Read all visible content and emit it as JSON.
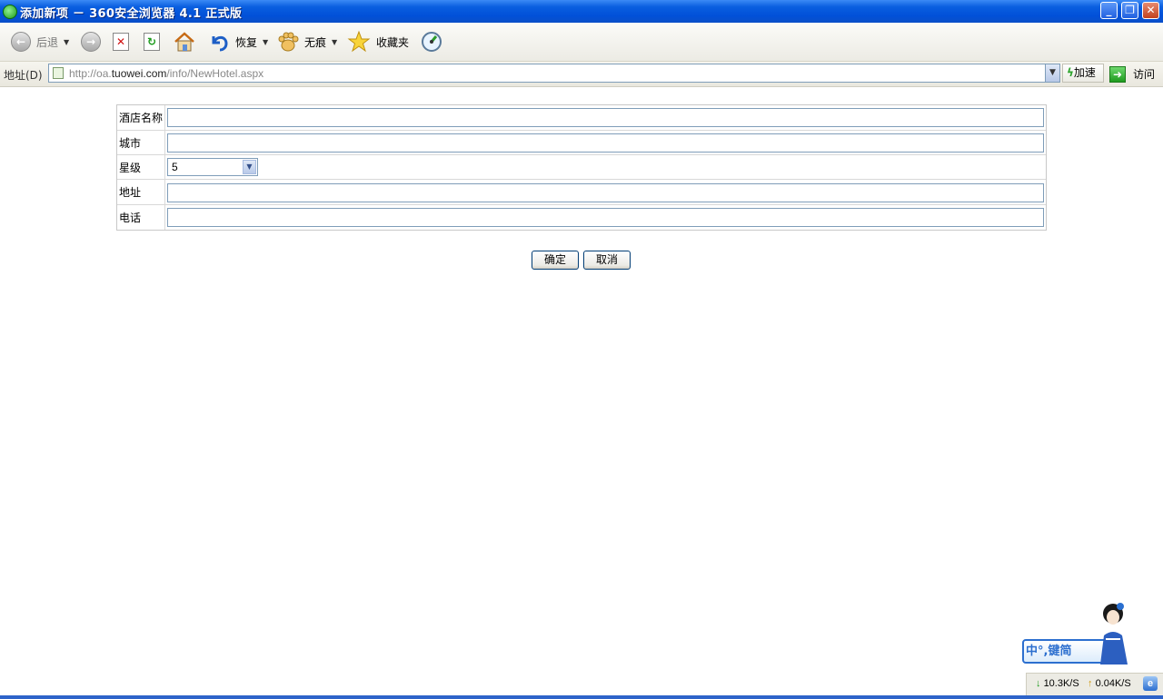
{
  "window": {
    "title": "添加新项 － 360安全浏览器 4.1 正式版",
    "minimize_glyph": "_",
    "restore_glyph": "❐",
    "close_glyph": "✕"
  },
  "toolbar": {
    "back_label": "后退",
    "restore_label": "恢复",
    "incognito_label": "无痕",
    "favorites_label": "收藏夹"
  },
  "address": {
    "label": "地址(D)",
    "url_prefix": "http://oa.",
    "url_domain": "tuowei.com",
    "url_path": "/info/NewHotel.aspx",
    "speedup_label": "加速",
    "visit_label": "访问"
  },
  "form": {
    "fields": [
      {
        "label": "酒店名称",
        "value": ""
      },
      {
        "label": "城市",
        "value": ""
      },
      {
        "label": "星级",
        "value": "5"
      },
      {
        "label": "地址",
        "value": ""
      },
      {
        "label": "电话",
        "value": ""
      }
    ],
    "ok_label": "确定",
    "cancel_label": "取消"
  },
  "ime": {
    "text": "中°,键简"
  },
  "status": {
    "download": "10.3K/S",
    "upload": "0.04K/S"
  },
  "colors": {
    "titlebar": "#0150d8",
    "input_border": "#7f9db9",
    "accent_green": "#1a9a1a"
  }
}
